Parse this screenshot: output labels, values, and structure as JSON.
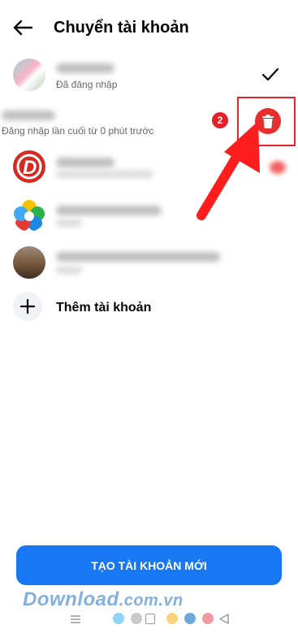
{
  "header": {
    "title": "Chuyển tài khoản"
  },
  "current_account": {
    "status": "Đã đăng nhập"
  },
  "selected_account": {
    "last_login": "Đăng nhập lần cuối từ 0 phút trước"
  },
  "annotation": {
    "step_number": "2"
  },
  "add_account": {
    "label": "Thêm tài khoản"
  },
  "create_button": {
    "label": "TẠO TÀI KHOẢN MỚI"
  },
  "watermark": {
    "main": "Download",
    "suffix": ".com.vn"
  },
  "icons": {
    "back": "arrow-left-icon",
    "check": "check-icon",
    "trash": "trash-icon",
    "add": "plus-icon"
  },
  "colors": {
    "accent": "#1877f2",
    "danger": "#e62e2e",
    "annotation": "#e8222a"
  }
}
